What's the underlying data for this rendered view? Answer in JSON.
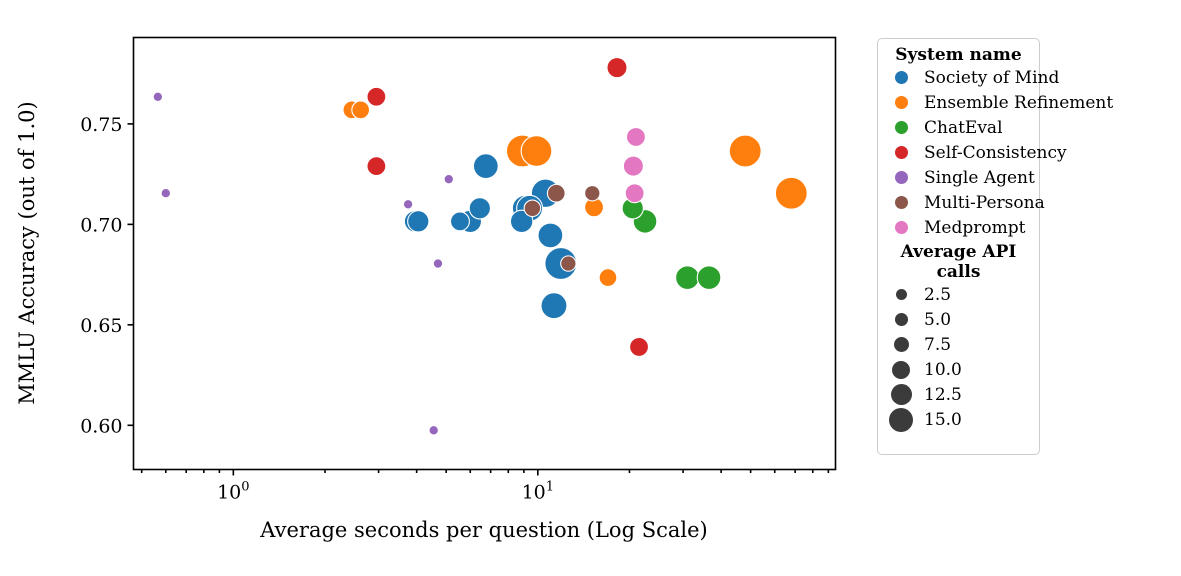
{
  "chart_data": {
    "type": "scatter",
    "title": "",
    "xlabel": "Average seconds per question (Log Scale)",
    "ylabel": "MMLU Accuracy (out of 1.0)",
    "xscale": "log",
    "xlim": [
      0.47,
      95
    ],
    "ylim": [
      0.578,
      0.793
    ],
    "xticks": [
      1,
      10
    ],
    "xticklabels": [
      "10⁰",
      "10¹"
    ],
    "yticks": [
      0.6,
      0.65,
      0.7,
      0.75
    ],
    "yticklabels": [
      "0.60",
      "0.65",
      "0.70",
      "0.75"
    ],
    "grid": false,
    "legend_position": "right-outside",
    "size_legend_title": "Average API calls",
    "size_legend_values": [
      "2.5",
      "5.0",
      "7.5",
      "10.0",
      "12.5",
      "15.0"
    ],
    "legend_title": "System name",
    "series": [
      {
        "name": "Society of Mind",
        "color": "#1f77b4",
        "points": [
          {
            "x": 3.95,
            "y": 0.7015,
            "s": 9.0
          },
          {
            "x": 4.05,
            "y": 0.7015,
            "s": 9.0
          },
          {
            "x": 5.55,
            "y": 0.7015,
            "s": 8.0
          },
          {
            "x": 6.0,
            "y": 0.7015,
            "s": 9.5
          },
          {
            "x": 6.45,
            "y": 0.708,
            "s": 9.0
          },
          {
            "x": 6.75,
            "y": 0.729,
            "s": 10.5
          },
          {
            "x": 8.85,
            "y": 0.7015,
            "s": 9.5
          },
          {
            "x": 9.1,
            "y": 0.708,
            "s": 11.0
          },
          {
            "x": 9.4,
            "y": 0.708,
            "s": 11.0
          },
          {
            "x": 10.6,
            "y": 0.7155,
            "s": 12.0
          },
          {
            "x": 11.0,
            "y": 0.6945,
            "s": 10.5
          },
          {
            "x": 11.9,
            "y": 0.6805,
            "s": 13.5
          },
          {
            "x": 11.3,
            "y": 0.6595,
            "s": 11.0
          }
        ]
      },
      {
        "name": "Ensemble Refinement",
        "color": "#ff7f0e",
        "points": [
          {
            "x": 2.45,
            "y": 0.757,
            "s": 7.5
          },
          {
            "x": 2.62,
            "y": 0.757,
            "s": 7.5
          },
          {
            "x": 8.9,
            "y": 0.7365,
            "s": 13.5
          },
          {
            "x": 9.9,
            "y": 0.7365,
            "s": 13.0
          },
          {
            "x": 15.3,
            "y": 0.7085,
            "s": 8.0
          },
          {
            "x": 17.0,
            "y": 0.6735,
            "s": 7.5
          },
          {
            "x": 48.0,
            "y": 0.7365,
            "s": 13.5
          },
          {
            "x": 68.0,
            "y": 0.7155,
            "s": 13.5
          }
        ]
      },
      {
        "name": "ChatEval",
        "color": "#2ca02c",
        "points": [
          {
            "x": 20.5,
            "y": 0.708,
            "s": 9.0
          },
          {
            "x": 22.5,
            "y": 0.7015,
            "s": 10.0
          },
          {
            "x": 31.0,
            "y": 0.6735,
            "s": 10.0
          },
          {
            "x": 36.5,
            "y": 0.6735,
            "s": 10.0
          }
        ]
      },
      {
        "name": "Self-Consistency",
        "color": "#d62728",
        "points": [
          {
            "x": 2.95,
            "y": 0.7635,
            "s": 8.0
          },
          {
            "x": 2.95,
            "y": 0.729,
            "s": 8.0
          },
          {
            "x": 18.2,
            "y": 0.778,
            "s": 8.5
          },
          {
            "x": 21.5,
            "y": 0.639,
            "s": 8.0
          }
        ]
      },
      {
        "name": "Single Agent",
        "color": "#9467bd",
        "points": [
          {
            "x": 0.565,
            "y": 0.7635,
            "s": 4.0
          },
          {
            "x": 0.6,
            "y": 0.7155,
            "s": 4.0
          },
          {
            "x": 3.75,
            "y": 0.71,
            "s": 4.0
          },
          {
            "x": 5.1,
            "y": 0.7225,
            "s": 4.0
          },
          {
            "x": 4.7,
            "y": 0.6805,
            "s": 4.0
          },
          {
            "x": 4.55,
            "y": 0.5975,
            "s": 4.0
          }
        ]
      },
      {
        "name": "Multi-Persona",
        "color": "#8c564b",
        "points": [
          {
            "x": 9.6,
            "y": 0.708,
            "s": 7.0
          },
          {
            "x": 11.5,
            "y": 0.7155,
            "s": 7.5
          },
          {
            "x": 12.6,
            "y": 0.6805,
            "s": 6.5
          },
          {
            "x": 15.1,
            "y": 0.7155,
            "s": 6.5
          }
        ]
      },
      {
        "name": "Medprompt",
        "color": "#e377c2",
        "points": [
          {
            "x": 21.0,
            "y": 0.7435,
            "s": 8.0
          },
          {
            "x": 20.6,
            "y": 0.729,
            "s": 8.5
          },
          {
            "x": 20.8,
            "y": 0.7155,
            "s": 8.0
          }
        ]
      }
    ]
  },
  "legend": {
    "title": "System name",
    "entries": [
      {
        "label": "Society of Mind",
        "color": "#1f77b4"
      },
      {
        "label": "Ensemble Refinement",
        "color": "#ff7f0e"
      },
      {
        "label": "ChatEval",
        "color": "#2ca02c"
      },
      {
        "label": "Self-Consistency",
        "color": "#d62728"
      },
      {
        "label": "Single Agent",
        "color": "#9467bd"
      },
      {
        "label": "Multi-Persona",
        "color": "#8c564b"
      },
      {
        "label": "Medprompt",
        "color": "#e377c2"
      }
    ],
    "size_title": "Average API calls",
    "size_entries": [
      {
        "label": "2.5",
        "d": 11
      },
      {
        "label": "5.0",
        "d": 13
      },
      {
        "label": "7.5",
        "d": 15
      },
      {
        "label": "10.0",
        "d": 18
      },
      {
        "label": "12.5",
        "d": 21
      },
      {
        "label": "15.0",
        "d": 24
      }
    ],
    "size_swatch_color": "#3b3b3b"
  },
  "axes": {
    "xlabel": "Average seconds per question (Log Scale)",
    "ylabel": "MMLU Accuracy (out of 1.0)",
    "yticklabels": [
      "0.75",
      "0.70",
      "0.65",
      "0.60"
    ],
    "xtick_bases": [
      "10",
      "10"
    ],
    "xtick_exps": [
      "0",
      "1"
    ]
  }
}
